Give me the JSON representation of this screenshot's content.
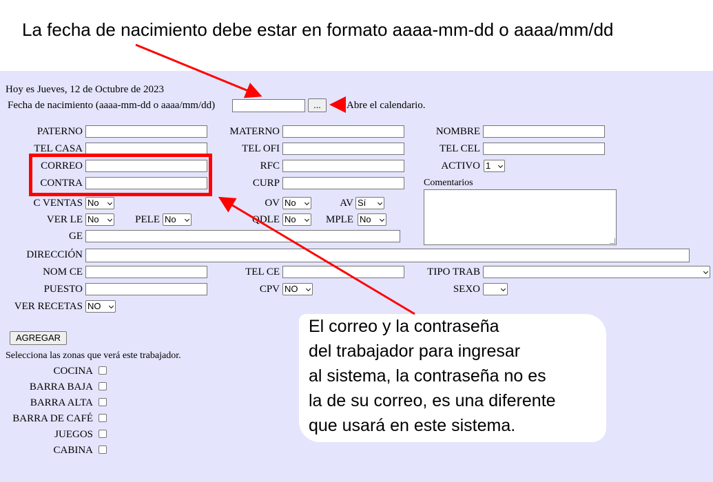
{
  "annotations": {
    "title": "La fecha de nacimiento debe estar en formato aaaa-mm-dd o aaaa/mm/dd",
    "calendar_hint": "Abre el calendario.",
    "callout_lines": [
      "El correo y la contraseña",
      "del trabajador para ingresar",
      "al sistema, la contraseña no es",
      "la de su correo, es una diferente",
      "que usará en este sistema."
    ],
    "accent_color": "#ff0000"
  },
  "header": {
    "today": "Hoy es Jueves, 12 de Octubre de 2023",
    "birthdate_label": "Fecha de nacimiento (aaaa-mm-dd o aaaa/mm/dd)",
    "calendar_button": "..."
  },
  "fields": {
    "paterno": "PATERNO",
    "materno": "MATERNO",
    "nombre": "NOMBRE",
    "tel_casa": "TEL CASA",
    "tel_ofi": "TEL OFI",
    "tel_cel": "TEL CEL",
    "correo": "CORREO",
    "rfc": "RFC",
    "activo": "ACTIVO",
    "activo_value": "1",
    "contra": "CONTRA",
    "curp": "CURP",
    "comentarios": "Comentarios",
    "c_ventas": "C VENTAS",
    "c_ventas_value": "No",
    "ov": "OV",
    "ov_value": "No",
    "av": "AV",
    "av_value": "Sí",
    "ver_le": "VER LE",
    "ver_le_value": "No",
    "pele": "PELE",
    "pele_value": "No",
    "qdle": "QDLE",
    "qdle_value": "No",
    "mple": "MPLE",
    "mple_value": "No",
    "ge": "GE",
    "direccion": "DIRECCIÓN",
    "nom_ce": "NOM CE",
    "tel_ce": "TEL CE",
    "tipo_trab": "TIPO TRAB",
    "puesto": "PUESTO",
    "cpv": "CPV",
    "cpv_value": "NO",
    "sexo": "SEXO",
    "ver_recetas": "VER RECETAS",
    "ver_recetas_value": "NO"
  },
  "actions": {
    "agregar": "AGREGAR"
  },
  "zones": {
    "prompt": "Selecciona las zonas que verá este trabajador.",
    "items": [
      "COCINA",
      "BARRA BAJA",
      "BARRA ALTA",
      "BARRA DE CAFÉ",
      "JUEGOS",
      "CABINA"
    ]
  }
}
